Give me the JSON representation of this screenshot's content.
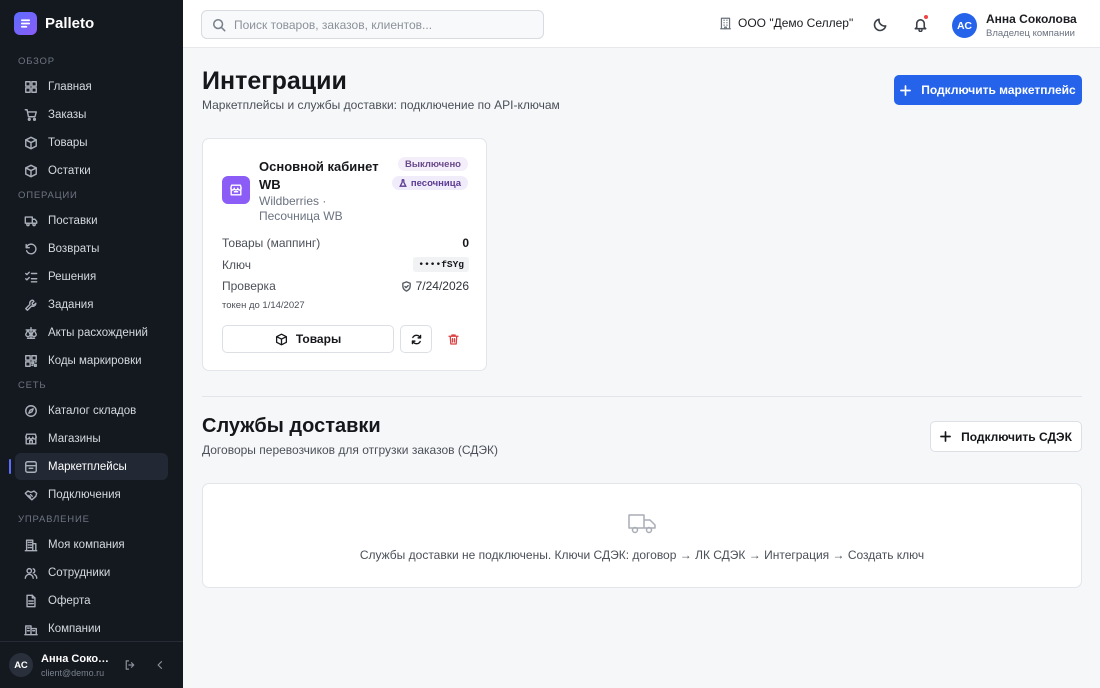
{
  "app": {
    "name": "Palleto"
  },
  "sidebar": {
    "sections": [
      {
        "title": "ОБЗОР",
        "items": [
          {
            "label": "Главная",
            "icon": "dashboard-icon"
          },
          {
            "label": "Заказы",
            "icon": "cart-icon"
          },
          {
            "label": "Товары",
            "icon": "box-icon"
          },
          {
            "label": "Остатки",
            "icon": "box-icon"
          }
        ]
      },
      {
        "title": "ОПЕРАЦИИ",
        "items": [
          {
            "label": "Поставки",
            "icon": "truck-icon"
          },
          {
            "label": "Возвраты",
            "icon": "undo-icon"
          },
          {
            "label": "Решения",
            "icon": "checklist-icon"
          },
          {
            "label": "Задания",
            "icon": "wrench-icon"
          },
          {
            "label": "Акты расхождений",
            "icon": "scale-icon"
          },
          {
            "label": "Коды маркировки",
            "icon": "qr-icon"
          }
        ]
      },
      {
        "title": "СЕТЬ",
        "items": [
          {
            "label": "Каталог складов",
            "icon": "compass-icon"
          },
          {
            "label": "Магазины",
            "icon": "store-icon"
          },
          {
            "label": "Маркетплейсы",
            "icon": "marketplace-icon",
            "active": true
          },
          {
            "label": "Подключения",
            "icon": "handshake-icon"
          }
        ]
      },
      {
        "title": "УПРАВЛЕНИЕ",
        "items": [
          {
            "label": "Моя компания",
            "icon": "building-icon"
          },
          {
            "label": "Сотрудники",
            "icon": "users-icon"
          },
          {
            "label": "Оферта",
            "icon": "document-icon"
          },
          {
            "label": "Компании",
            "icon": "buildings-icon"
          }
        ]
      }
    ],
    "footer": {
      "initials": "АС",
      "name": "Анна Соколова",
      "email": "client@demo.ru"
    }
  },
  "header": {
    "search_placeholder": "Поиск товаров, заказов, клиентов...",
    "company": "ООО \"Демо Селлер\"",
    "user": {
      "initials": "АС",
      "name": "Анна Соколова",
      "role": "Владелец компании"
    },
    "has_notifications": true
  },
  "page": {
    "title": "Интеграции",
    "subtitle": "Маркетплейсы и службы доставки: подключение по API-ключам",
    "connect_marketplace_label": "Подключить маркетплейс"
  },
  "card": {
    "title": "Основной кабинет WB",
    "subtitle": "Wildberries · Песочница WB",
    "badge_status": "Выключено",
    "badge_mode": "песочница",
    "rows": {
      "mapping_label": "Товары (маппинг)",
      "mapping_value": "0",
      "key_label": "Ключ",
      "key_value": "••••fSYg",
      "check_label": "Проверка",
      "check_value": "7/24/2026"
    },
    "token_note": "токен до 1/14/2027",
    "goods_button": "Товары"
  },
  "delivery": {
    "title": "Службы доставки",
    "subtitle": "Договоры перевозчиков для отгрузки заказов (СДЭК)",
    "connect_label": "Подключить СДЭК",
    "empty_text": "Службы доставки не подключены. Ключи СДЭК: договор → ЛК СДЭК → Интеграция → Создать ключ"
  },
  "colors": {
    "accent": "#2563eb",
    "sidebar_bg": "#14181f",
    "marketplace_logo": "#8b5cf6",
    "danger": "#dc4040"
  }
}
